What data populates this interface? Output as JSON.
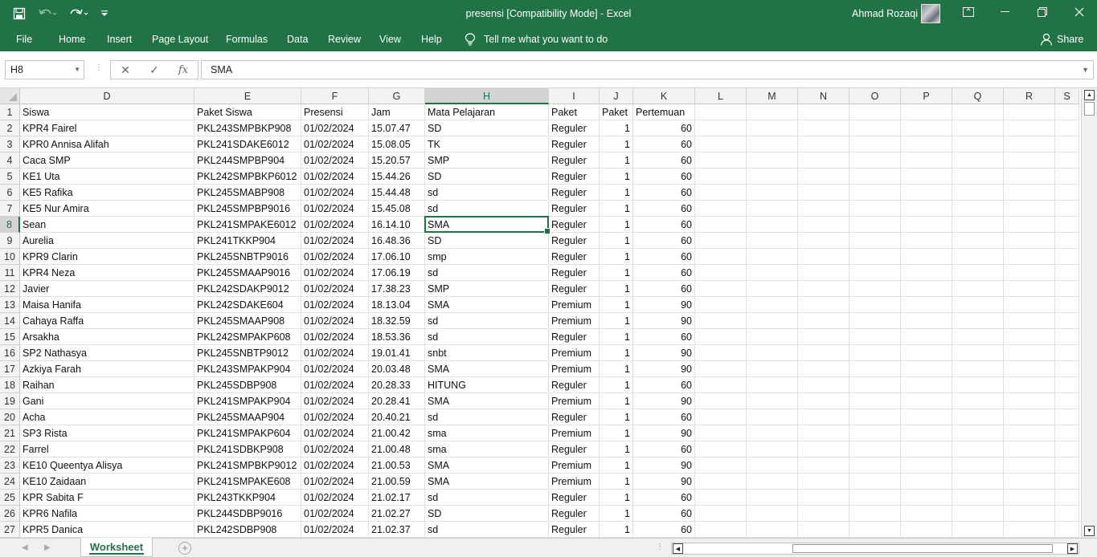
{
  "window": {
    "title": "presensi  [Compatibility Mode]  -  Excel",
    "user": "Ahmad Rozaqi"
  },
  "ribbon": {
    "tabs": [
      "File",
      "Home",
      "Insert",
      "Page Layout",
      "Formulas",
      "Data",
      "Review",
      "View",
      "Help"
    ],
    "tell_me": "Tell me what you want to do",
    "share": "Share"
  },
  "formula_bar": {
    "name_box": "H8",
    "formula": "SMA",
    "fx": "fx"
  },
  "columns": [
    {
      "letter": "D",
      "header": "Siswa"
    },
    {
      "letter": "E",
      "header": "Paket Siswa"
    },
    {
      "letter": "F",
      "header": "Presensi"
    },
    {
      "letter": "G",
      "header": "Jam"
    },
    {
      "letter": "H",
      "header": "Mata Pelajaran"
    },
    {
      "letter": "I",
      "header": "Paket"
    },
    {
      "letter": "J",
      "header": "Paket"
    },
    {
      "letter": "K",
      "header": "Pertemuan"
    },
    {
      "letter": "L",
      "header": ""
    },
    {
      "letter": "M",
      "header": ""
    },
    {
      "letter": "N",
      "header": ""
    },
    {
      "letter": "O",
      "header": ""
    },
    {
      "letter": "P",
      "header": ""
    },
    {
      "letter": "Q",
      "header": ""
    },
    {
      "letter": "R",
      "header": ""
    },
    {
      "letter": "S",
      "header": ""
    }
  ],
  "rows": [
    [
      "KPR4 Fairel",
      "PKL243SMPBKP908",
      "01/02/2024",
      "15.07.47",
      "SD",
      "Reguler",
      "1",
      "60"
    ],
    [
      "KPR0 Annisa Alifah",
      "PKL241SDAKE6012",
      "01/02/2024",
      "15.08.05",
      "TK",
      "Reguler",
      "1",
      "60"
    ],
    [
      "Caca SMP",
      "PKL244SMPBP904",
      "01/02/2024",
      "15.20.57",
      "SMP",
      "Reguler",
      "1",
      "60"
    ],
    [
      "KE1 Uta",
      "PKL242SMPBKP6012",
      "01/02/2024",
      "15.44.26",
      "SD",
      "Reguler",
      "1",
      "60"
    ],
    [
      "KE5 Rafika",
      "PKL245SMABP908",
      "01/02/2024",
      "15.44.48",
      "sd",
      "Reguler",
      "1",
      "60"
    ],
    [
      "KE5 Nur Amira",
      "PKL245SMPBP9016",
      "01/02/2024",
      "15.45.08",
      "sd",
      "Reguler",
      "1",
      "60"
    ],
    [
      "Sean",
      "PKL241SMPAKE6012",
      "01/02/2024",
      "16.14.10",
      "SMA",
      "Reguler",
      "1",
      "60"
    ],
    [
      "Aurelia",
      "PKL241TKKP904",
      "01/02/2024",
      "16.48.36",
      "SD",
      "Reguler",
      "1",
      "60"
    ],
    [
      "KPR9 Clarin",
      "PKL245SNBTP9016",
      "01/02/2024",
      "17.06.10",
      "smp",
      "Reguler",
      "1",
      "60"
    ],
    [
      "KPR4 Neza",
      "PKL245SMAAP9016",
      "01/02/2024",
      "17.06.19",
      "sd",
      "Reguler",
      "1",
      "60"
    ],
    [
      "Javier",
      "PKL242SDAKP9012",
      "01/02/2024",
      "17.38.23",
      "SMP",
      "Reguler",
      "1",
      "60"
    ],
    [
      "Maisa Hanifa",
      "PKL242SDAKE604",
      "01/02/2024",
      "18.13.04",
      "SMA",
      "Premium",
      "1",
      "90"
    ],
    [
      "Cahaya Raffa",
      "PKL245SMAAP908",
      "01/02/2024",
      "18.32.59",
      "sd",
      "Premium",
      "1",
      "90"
    ],
    [
      "Arsakha",
      "PKL242SMPAKP608",
      "01/02/2024",
      "18.53.36",
      "sd",
      "Reguler",
      "1",
      "60"
    ],
    [
      "SP2 Nathasya",
      "PKL245SNBTP9012",
      "01/02/2024",
      "19.01.41",
      "snbt",
      "Premium",
      "1",
      "90"
    ],
    [
      "Azkiya Farah",
      "PKL243SMPAKP904",
      "01/02/2024",
      "20.03.48",
      "SMA",
      "Premium",
      "1",
      "90"
    ],
    [
      "Raihan",
      "PKL245SDBP908",
      "01/02/2024",
      "20.28.33",
      "HITUNG",
      "Reguler",
      "1",
      "60"
    ],
    [
      "Gani",
      "PKL241SMPAKP904",
      "01/02/2024",
      "20.28.41",
      "SMA",
      "Premium",
      "1",
      "90"
    ],
    [
      "Acha",
      "PKL245SMAAP904",
      "01/02/2024",
      "20.40.21",
      "sd",
      "Reguler",
      "1",
      "60"
    ],
    [
      "SP3 Rista",
      "PKL241SMPAKP604",
      "01/02/2024",
      "21.00.42",
      "sma",
      "Premium",
      "1",
      "90"
    ],
    [
      "Farrel",
      "PKL241SDBKP908",
      "01/02/2024",
      "21.00.48",
      "sma",
      "Reguler",
      "1",
      "60"
    ],
    [
      "KE10 Queentya Alisya",
      "PKL241SMPBKP9012",
      "01/02/2024",
      "21.00.53",
      "SMA",
      "Premium",
      "1",
      "90"
    ],
    [
      "KE10 Zaidaan",
      "PKL241SMPAKE608",
      "01/02/2024",
      "21.00.59",
      "SMA",
      "Premium",
      "1",
      "90"
    ],
    [
      "KPR Sabita F",
      "PKL243TKKP904",
      "01/02/2024",
      "21.02.17",
      "sd",
      "Reguler",
      "1",
      "60"
    ],
    [
      "KPR6 Nafila",
      "PKL244SDBP9016",
      "01/02/2024",
      "21.02.27",
      "SD",
      "Reguler",
      "1",
      "60"
    ],
    [
      "KPR5 Danica",
      "PKL242SDBP908",
      "01/02/2024",
      "21.02.37",
      "sd",
      "Reguler",
      "1",
      "60"
    ]
  ],
  "selection": {
    "column": "H",
    "row": "8"
  },
  "sheets": [
    "Worksheet"
  ],
  "colors": {
    "accent": "#217346"
  }
}
